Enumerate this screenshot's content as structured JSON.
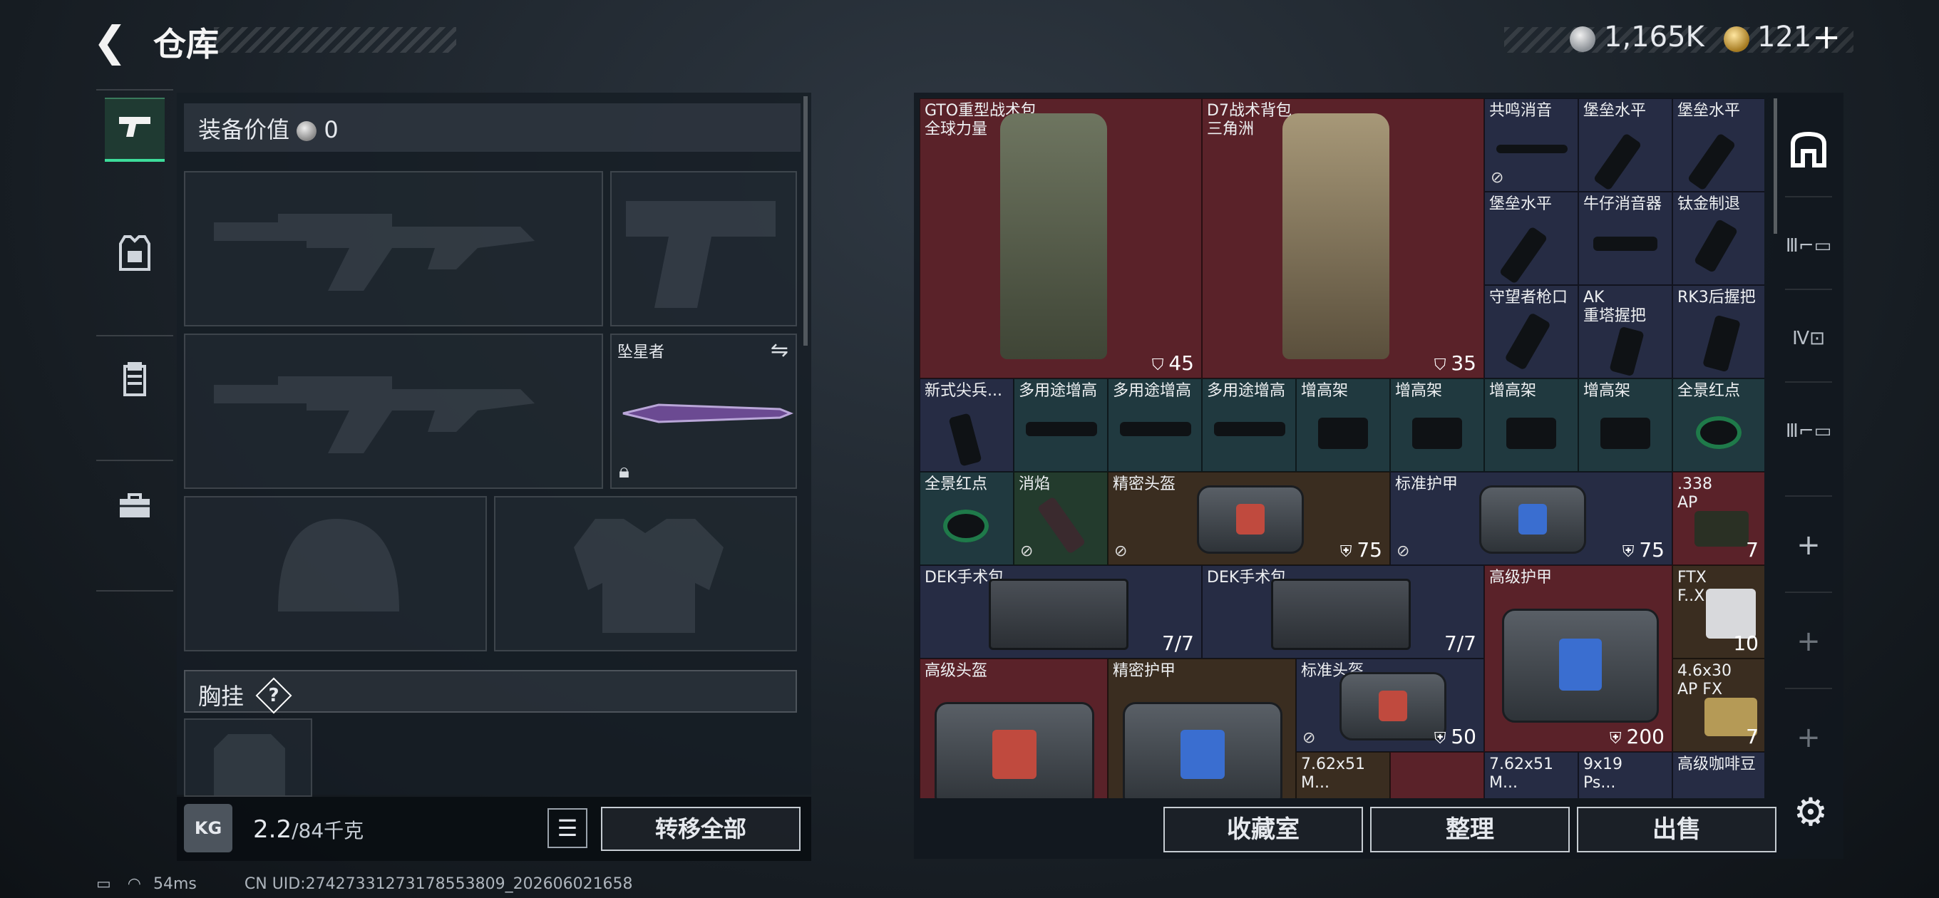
{
  "header": {
    "title": "仓库",
    "money": "1,165K",
    "tickets": "121",
    "plus": "+"
  },
  "equipment": {
    "value_label": "装备价值",
    "value": "0",
    "melee_name": "坠星者",
    "chest_label": "胸挂",
    "chest_help": "?"
  },
  "footer_left": {
    "kg_label": "KG",
    "weight": "2.2",
    "capacity": "/84千克",
    "transfer_all": "转移全部"
  },
  "footer_right": {
    "collection": "收藏室",
    "sort": "整理",
    "sell": "出售"
  },
  "status": {
    "ping": "54ms",
    "uid": "CN UID:27427331273178553809_202606021658"
  },
  "left_nav": [
    "pistol-icon",
    "armor-vest-icon",
    "chest-rig-icon",
    "toolbox-icon"
  ],
  "right_nav": [
    "safe-box-icon",
    "gun-tier-3-icon",
    "gun-tier-4-icon",
    "gun-tier-3b-icon",
    "+",
    "+",
    "+"
  ],
  "items": [
    {
      "name": "GTO重型战术包\n全球力量",
      "count": "45"
    },
    {
      "name": "D7战术背包\n三角洲",
      "count": "35"
    },
    {
      "name": "共鸣消音"
    },
    {
      "name": "堡垒水平"
    },
    {
      "name": "堡垒水平"
    },
    {
      "name": "堡垒水平"
    },
    {
      "name": "牛仔消音器"
    },
    {
      "name": "钛金制退"
    },
    {
      "name": "守望者枪口"
    },
    {
      "name": "AK\n重塔握把"
    },
    {
      "name": "RK3后握把"
    },
    {
      "name": "新式尖兵..."
    },
    {
      "name": "多用途增高"
    },
    {
      "name": "多用途增高"
    },
    {
      "name": "多用途增高"
    },
    {
      "name": "增高架"
    },
    {
      "name": "增高架"
    },
    {
      "name": "增高架"
    },
    {
      "name": "增高架"
    },
    {
      "name": "全景红点"
    },
    {
      "name": "全景红点"
    },
    {
      "name": "消焰"
    },
    {
      "name": "精密头盔",
      "count": "75"
    },
    {
      "name": "标准护甲",
      "count": "75"
    },
    {
      "name": ".338\nAP",
      "count": "7"
    },
    {
      "name": "DEK手术包",
      "count": "7/7"
    },
    {
      "name": "DEK手术包",
      "count": "7/7"
    },
    {
      "name": "高级护甲",
      "count": "200"
    },
    {
      "name": "FTX\nF..X.W",
      "count": "10"
    },
    {
      "name": "高级头盔"
    },
    {
      "name": "精密护甲"
    },
    {
      "name": "标准头盔",
      "count": "50"
    },
    {
      "name": "4.6x30\nAP FX",
      "count": "7"
    },
    {
      "name": "7.62x51\nM..."
    },
    {
      "name": "7.62x51\nM..."
    },
    {
      "name": "9x19\nPs..."
    },
    {
      "name": "高级咖啡豆"
    }
  ],
  "colors": {
    "accent": "#3ddc9a",
    "red_cell": "#5a2229",
    "navy_cell": "#262c44"
  }
}
